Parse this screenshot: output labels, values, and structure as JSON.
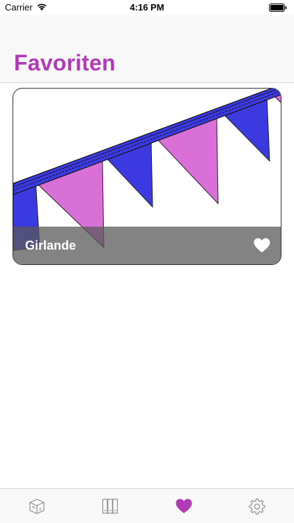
{
  "status_bar": {
    "carrier": "Carrier",
    "time": "4:16 PM"
  },
  "page": {
    "title": "Favoriten"
  },
  "card": {
    "title": "Girlande",
    "favorited": true
  },
  "tabs": [
    {
      "icon": "cube-icon",
      "selected": false
    },
    {
      "icon": "books-icon",
      "selected": false
    },
    {
      "icon": "heart-icon",
      "selected": true
    },
    {
      "icon": "gear-icon",
      "selected": false
    }
  ],
  "colors": {
    "accent": "#b23ab8",
    "tab_inactive": "#8e8e93",
    "pennant_blue": "#3a3ae0",
    "pennant_pink": "#d870d8"
  }
}
